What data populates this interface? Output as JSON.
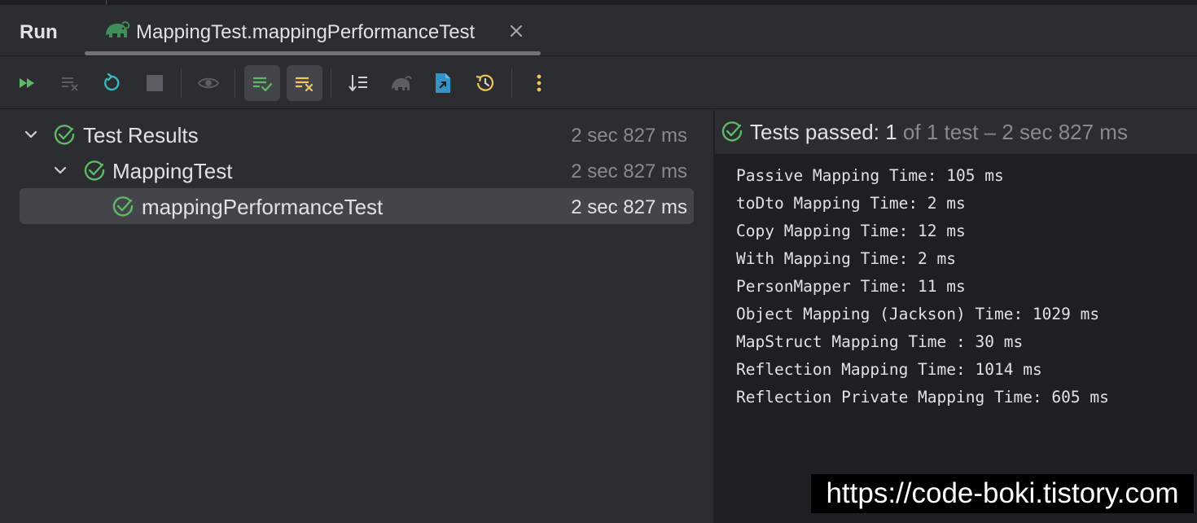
{
  "window": {
    "panel_title": "Run",
    "tab": {
      "label": "MappingTest.mappingPerformanceTest",
      "icon": "gradle-elephant-icon"
    }
  },
  "toolbar": {
    "buttons": [
      {
        "name": "rerun-failed-tests-button",
        "icon": "double-play-icon"
      },
      {
        "name": "rerun-failed-button",
        "icon": "lines-x-icon"
      },
      {
        "name": "rerun-button",
        "icon": "refresh-icon"
      },
      {
        "name": "stop-button",
        "icon": "stop-square-icon"
      },
      {
        "name": "show-ignored-button",
        "icon": "eye-icon"
      },
      {
        "name": "show-passed-button",
        "icon": "lines-check-icon",
        "active": true
      },
      {
        "name": "show-failed-button",
        "icon": "lines-x-yellow-icon",
        "active": true
      },
      {
        "name": "sort-button",
        "icon": "sort-icon"
      },
      {
        "name": "gradle-button",
        "icon": "gradle-icon"
      },
      {
        "name": "export-results-button",
        "icon": "export-file-icon"
      },
      {
        "name": "test-history-button",
        "icon": "history-clock-icon"
      },
      {
        "name": "more-options-button",
        "icon": "vertical-dots-icon"
      }
    ]
  },
  "tree": {
    "rows": [
      {
        "name": "Test Results",
        "duration": "2 sec 827 ms",
        "level": 0,
        "expanded": true
      },
      {
        "name": "MappingTest",
        "duration": "2 sec 827 ms",
        "level": 1,
        "expanded": true
      },
      {
        "name": "mappingPerformanceTest",
        "duration": "2 sec 827 ms",
        "level": 2,
        "selected": true
      }
    ]
  },
  "console": {
    "status": {
      "label": "Tests passed:",
      "count": "1",
      "rest": "of 1 test – 2 sec 827 ms"
    },
    "output": [
      "Passive Mapping Time: 105 ms",
      "toDto Mapping Time: 2 ms",
      "Copy Mapping Time: 12 ms",
      "With Mapping Time: 2 ms",
      "PersonMapper Time: 11 ms",
      "Object Mapping (Jackson) Time: 1029 ms",
      "MapStruct Mapping Time : 30 ms",
      "Reflection Mapping Time: 1014 ms",
      "Reflection Private Mapping Time: 605 ms"
    ]
  },
  "colors": {
    "pass_green": "#5fb865",
    "accent_blue": "#3592c4",
    "yellow": "#f2c55c",
    "background": "#2b2d30",
    "console_background": "#1e1f22"
  },
  "watermark": "https://code-boki.tistory.com"
}
